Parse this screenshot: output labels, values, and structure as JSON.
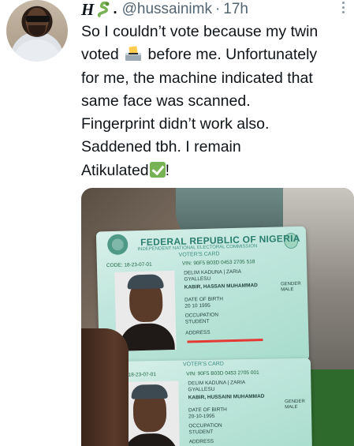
{
  "tweet": {
    "display_name": "H",
    "separator_dot": ".",
    "handle": "@hussainimk",
    "separator": "·",
    "time": "17h",
    "text_lines": [
      "So I couldn’t vote because my twin",
      "voted",
      "before me. Unfortunately",
      "for me, the machine indicated that",
      "same face was scanned.",
      "Fingerprint didn’t work also.",
      "Saddened tbh. I remain",
      "Atikulated",
      "!"
    ]
  },
  "icons": {
    "snake": "snake-emoji-icon",
    "ballot": "ballot-box-emoji-icon",
    "check": "check-mark-button-emoji-icon",
    "more": "more-options-icon"
  },
  "colors": {
    "text": "#0f1419",
    "secondary": "#536471",
    "card_green": "#2b7d6e",
    "check_green": "#77b255"
  },
  "media": {
    "card1": {
      "title": "FEDERAL REPUBLIC OF NIGERIA",
      "subtitle": "INDEPENDENT NATIONAL ELECTORAL COMMISSION",
      "card_type": "VOTER'S CARD",
      "code": "CODE: 18-23-07-01",
      "vin": "VIN: 90F5 B03D 0453 2705 518",
      "lga": "DELIM KADUNA | ZARIA",
      "ward": "GYALLESU",
      "name": "KABIR, HASSAN MUHAMMAD",
      "dob_label": "DATE OF BIRTH",
      "dob": "20 10 1995",
      "occupation_label": "OCCUPATION",
      "occupation": "STUDENT",
      "address_label": "ADDRESS",
      "gender_label": "GENDER",
      "gender": "MALE"
    },
    "card2": {
      "card_type": "VOTER'S CARD",
      "code": "CODE: 18-23-07-01",
      "vin": "VIN: 90F5 B03D 0453 2705 001",
      "lga": "DELIM KADUNA | ZARIA",
      "ward": "GYALLESU",
      "name": "KABIR, HUSSAINI MUHAMMAD",
      "dob_label": "DATE OF BIRTH",
      "dob": "20-10-1995",
      "occupation_label": "OCCUPATION",
      "occupation": "STUDENT",
      "address_label": "ADDRESS",
      "gender_label": "GENDER",
      "gender": "MALE"
    }
  }
}
